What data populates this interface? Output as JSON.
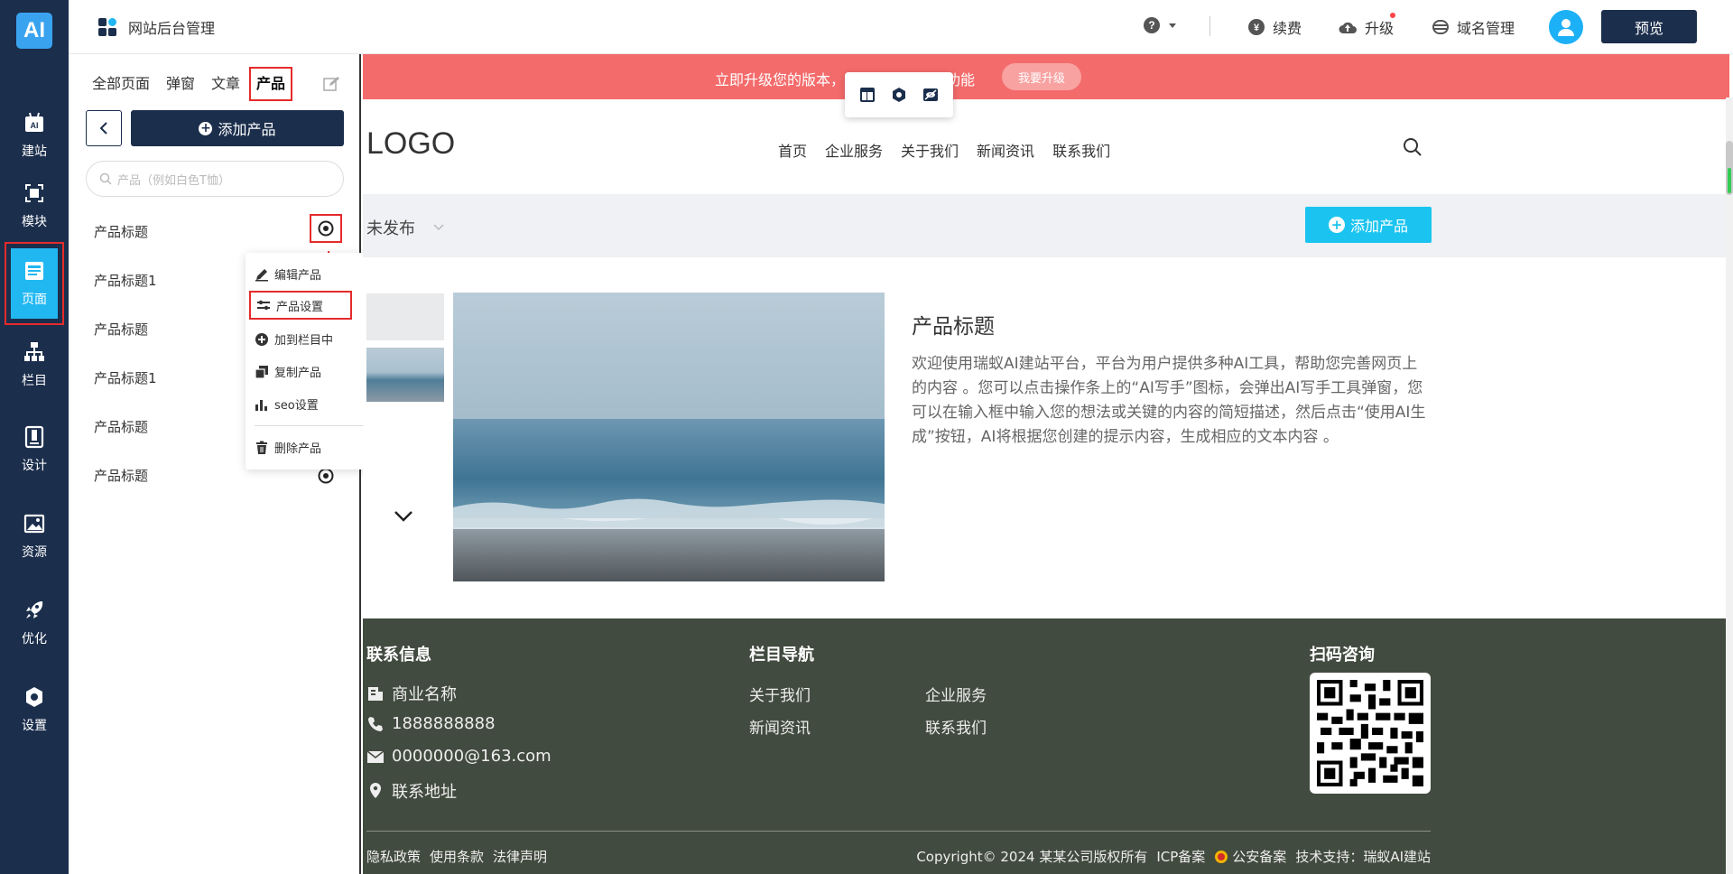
{
  "rail": {
    "logo": "AI",
    "items": [
      {
        "label": "建站",
        "icon": "ai-site-icon"
      },
      {
        "label": "模块",
        "icon": "module-icon"
      },
      {
        "label": "页面",
        "icon": "page-icon"
      },
      {
        "label": "栏目",
        "icon": "column-icon"
      },
      {
        "label": "设计",
        "icon": "design-icon"
      },
      {
        "label": "资源",
        "icon": "resource-icon"
      },
      {
        "label": "优化",
        "icon": "rocket-icon"
      },
      {
        "label": "设置",
        "icon": "settings-icon"
      }
    ]
  },
  "header": {
    "title": "网站后台管理",
    "renew": "续费",
    "upgrade": "升级",
    "domain": "域名管理",
    "preview": "预览"
  },
  "panel": {
    "tabs": [
      "全部页面",
      "弹窗",
      "文章",
      "产品"
    ],
    "add_button": "添加产品",
    "search_placeholder": "产品（例如白色T恤）",
    "products": [
      "产品标题",
      "产品标题1",
      "产品标题",
      "产品标题1",
      "产品标题",
      "产品标题"
    ]
  },
  "context_menu": {
    "edit": "编辑产品",
    "settings": "产品设置",
    "add_to_column": "加到栏目中",
    "copy": "复制产品",
    "seo": "seo设置",
    "delete": "删除产品"
  },
  "canvas": {
    "banner_text": "立即升级您的版本，以获取所有高级功能",
    "banner_button": "我要升级",
    "logo": "LOGO",
    "nav": [
      "首页",
      "企业服务",
      "关于我们",
      "新闻资讯",
      "联系我们"
    ],
    "status": "未发布",
    "add_product": "添加产品",
    "product_title": "产品标题",
    "product_desc": "欢迎使用瑞蚁AI建站平台，平台为用户提供多种AI工具，帮助您完善网页上的内容 。您可以点击操作条上的“AI写手”图标，会弹出AI写手工具弹窗，您可以在输入框中输入您的想法或关键的内容的简短描述，然后点击“使用AI生成”按钮，AI将根据您创建的提示内容，生成相应的文本内容 。"
  },
  "footer": {
    "contact_head": "联系信息",
    "company": "商业名称",
    "phone": "1888888888",
    "email": "0000000@163.com",
    "address": "联系地址",
    "nav_head": "栏目导航",
    "links": [
      "关于我们",
      "企业服务",
      "新闻资讯",
      "联系我们"
    ],
    "qr_head": "扫码咨询",
    "bottom_left": [
      "隐私政策",
      "使用条款",
      "法律声明"
    ],
    "copyright": "Copyright© 2024 某某公司版权所有",
    "icp": "ICP备案",
    "police": "公安备案",
    "support": "技术支持：瑞蚁AI建站"
  },
  "colors": {
    "rail_bg": "#1b2e4c",
    "active": "#21b8f2",
    "highlight": "#e52b2b",
    "banner": "#f46b6b",
    "footer": "#424b3f",
    "cta": "#1bc4f0"
  }
}
